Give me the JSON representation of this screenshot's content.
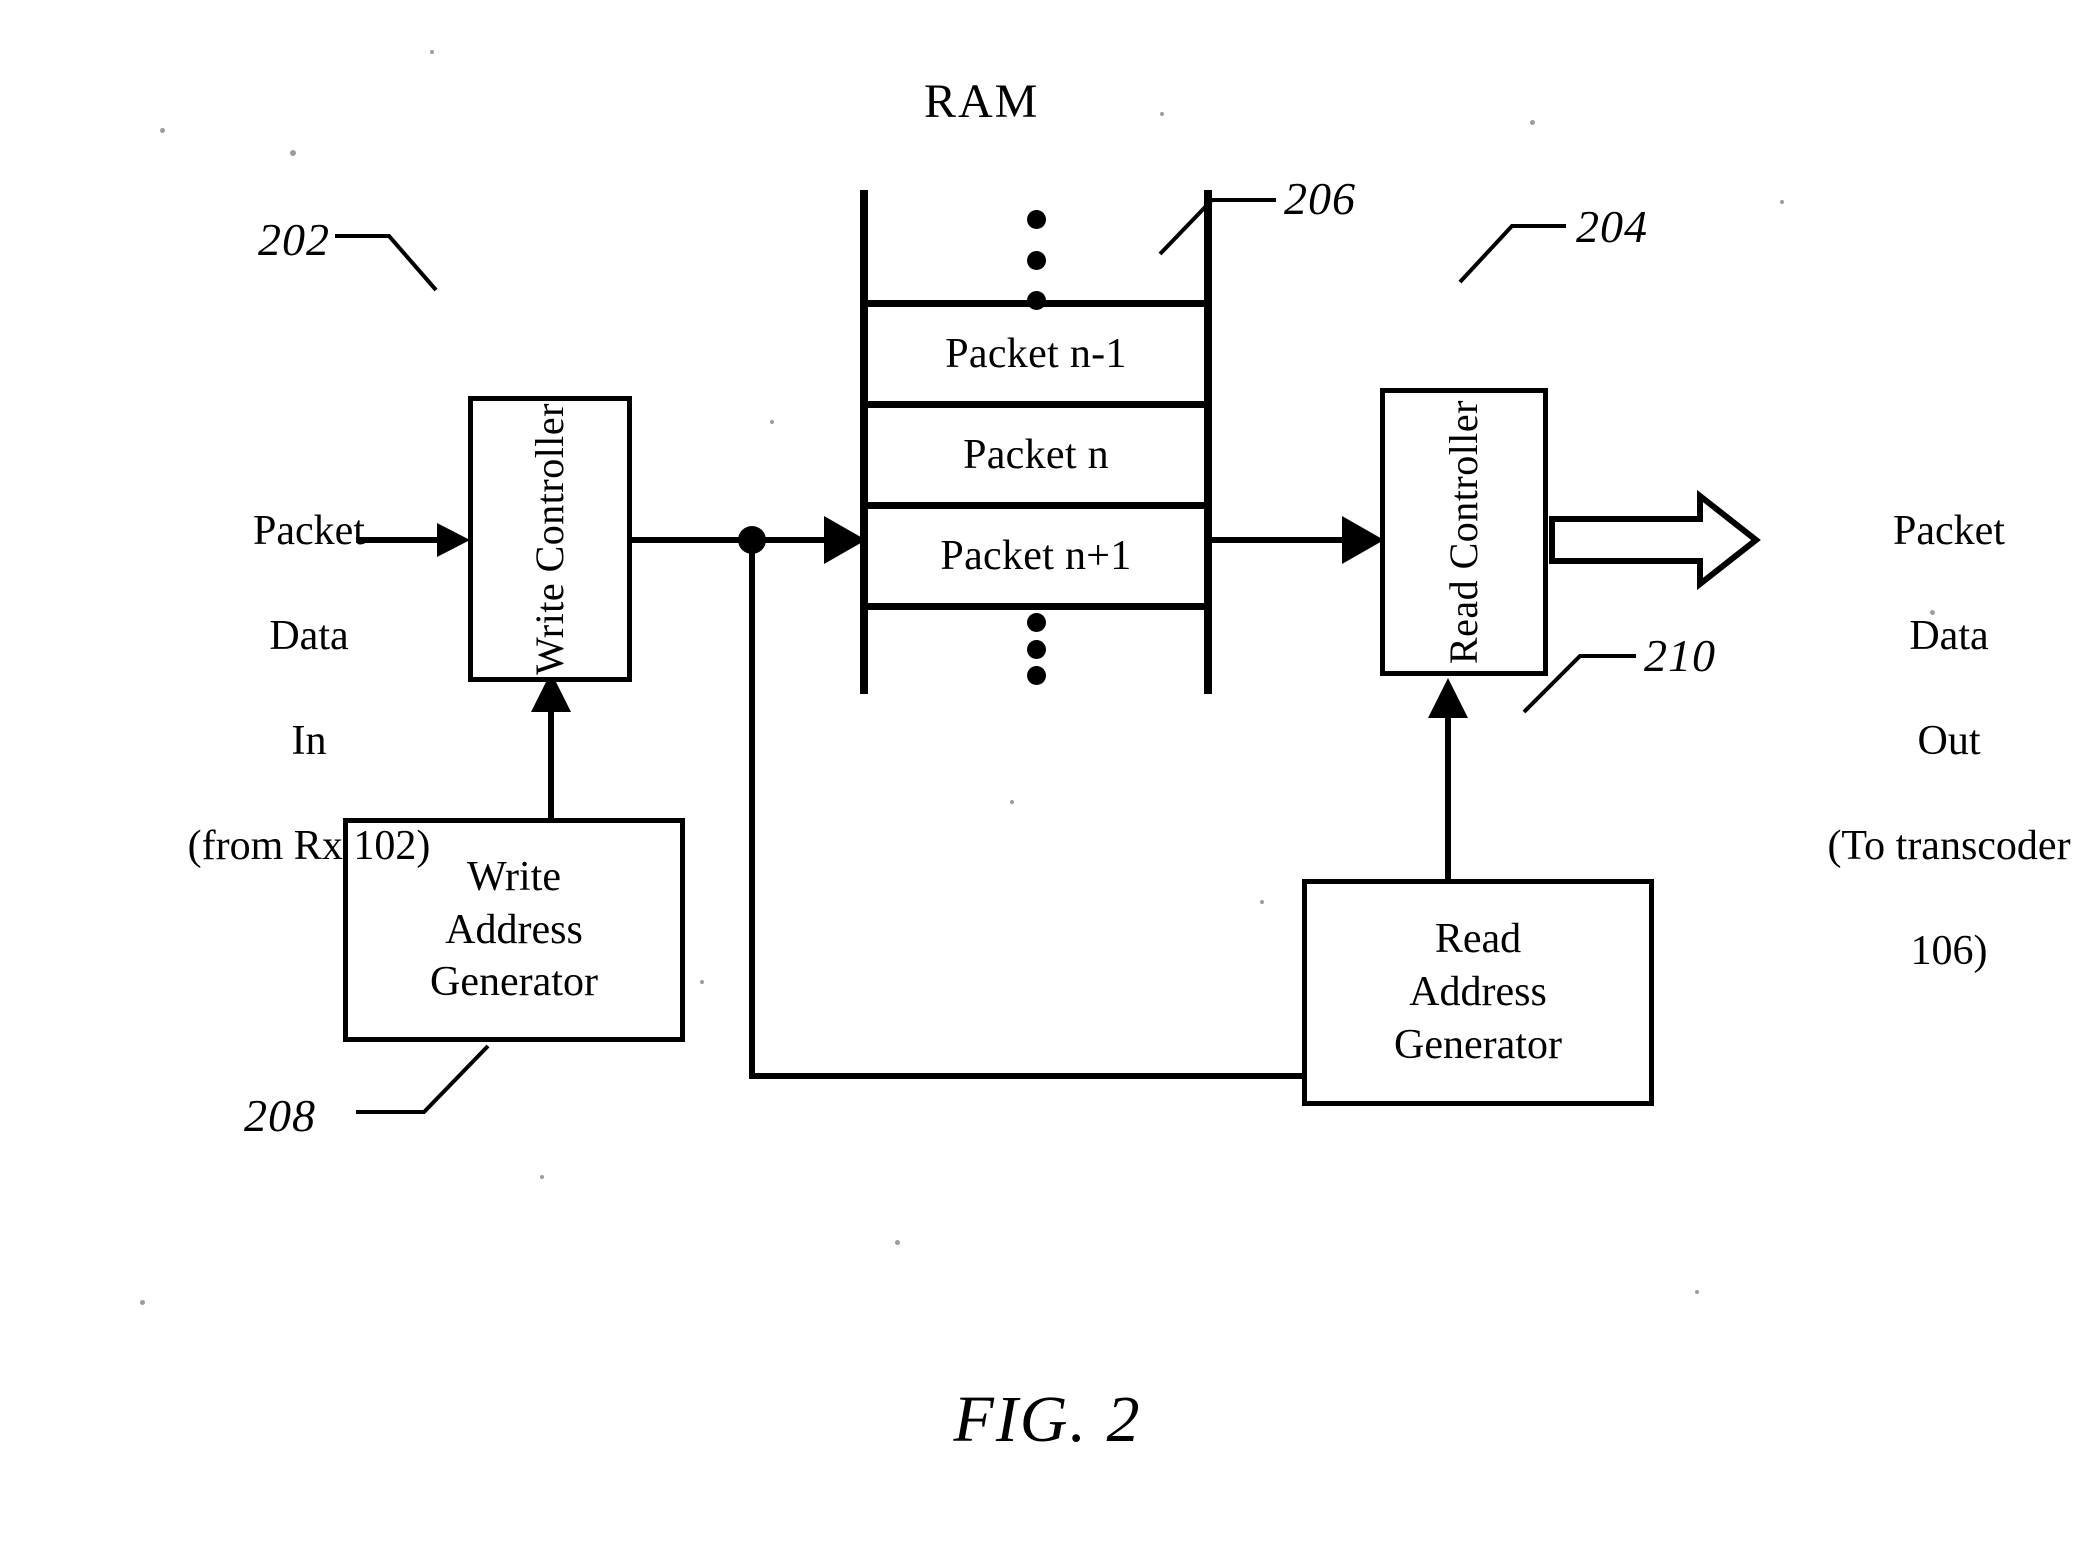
{
  "figure": {
    "caption": "FIG. 2",
    "ram_title": "RAM"
  },
  "blocks": {
    "write_controller": {
      "label": "Write Controller",
      "ref": "202"
    },
    "read_controller": {
      "label": "Read Controller",
      "ref": "204"
    },
    "write_address_generator": {
      "line1": "Write",
      "line2": "Address",
      "line3": "Generator",
      "ref": "208"
    },
    "read_address_generator": {
      "line1": "Read",
      "line2": "Address",
      "line3": "Generator",
      "ref": "210"
    }
  },
  "ram": {
    "ref": "206",
    "cells": [
      {
        "label": "Packet n-1"
      },
      {
        "label": "Packet n"
      },
      {
        "label": "Packet n+1"
      }
    ],
    "top_ellipsis": "⋮",
    "bottom_ellipsis": "⋮"
  },
  "io": {
    "input": {
      "line1": "Packet",
      "line2": "Data",
      "line3": "In",
      "line4": "(from Rx 102)"
    },
    "output": {
      "line1": "Packet",
      "line2": "Data",
      "line3": "Out",
      "line4": "(To transcoder",
      "line5": "106)"
    }
  },
  "refs": {
    "r202": "202",
    "r204": "204",
    "r206": "206",
    "r208": "208",
    "r210": "210"
  }
}
